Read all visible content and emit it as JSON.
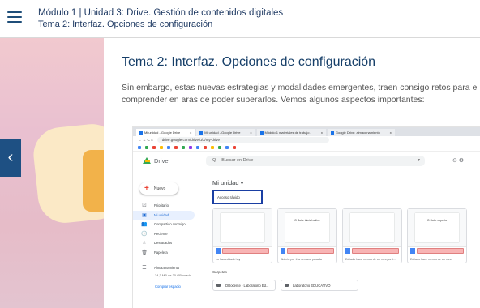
{
  "header": {
    "breadcrumb": "Módulo 1 | Unidad 3: Drive. Gestión de contenidos digitales",
    "subtitle": "Tema 2: Interfaz. Opciones de configuración"
  },
  "nav": {
    "prev_icon": "chevron-left-icon",
    "prev_glyph": "‹"
  },
  "content": {
    "title": "Tema 2: Interfaz. Opciones de configuración",
    "paragraph": "Sin embargo, estas nuevas estrategias y modalidades emergentes, traen consigo retos para el comprender en aras de poder superarlos. Vemos algunos aspectos importantes:"
  },
  "screenshot": {
    "tabs": [
      {
        "label": "Mi unidad - Google Drive",
        "close": "x"
      },
      {
        "label": "Mi unidad - Google Drive",
        "close": "x"
      },
      {
        "label": "Módulo 1 materiales de trabajo -",
        "close": "x"
      },
      {
        "label": "Google Drive: almacenamiento",
        "close": "x"
      }
    ],
    "url": "drive.google.com/drive/u/3/my-drive",
    "drive_label": "Drive",
    "search_placeholder": "Buscar en Drive",
    "new_button": "Nuevo",
    "sidebar": [
      {
        "icon": "☑",
        "label": "Prioritario"
      },
      {
        "icon": "▣",
        "label": "Mi unidad"
      },
      {
        "icon": "👥",
        "label": "Compartido conmigo"
      },
      {
        "icon": "🕒",
        "label": "Reciente"
      },
      {
        "icon": "☆",
        "label": "Destacados"
      },
      {
        "icon": "🗑",
        "label": "Papelera"
      },
      {
        "icon": "☰",
        "label": "Almacenamiento"
      }
    ],
    "storage": "34,3 MB de 30 GB usado",
    "buy_storage": "Comprar espacio",
    "my_drive": "Mi unidad",
    "quick_access": "Acceso rápido",
    "cards": [
      {
        "doc_title": "",
        "foot": "Lo has editado hoy"
      },
      {
        "doc_title": "G Suite inicial online",
        "foot": "Abierto por ti la semana pasada"
      },
      {
        "doc_title": "",
        "foot": "Editado hace menos de un mes por t..."
      },
      {
        "doc_title": "G Suite experto",
        "foot": "Editado hace menos de un mes"
      }
    ],
    "folders_label": "Carpetas",
    "folders": [
      "IDDocente - Laboratorio Ed...",
      "Laboratorio EDUCATIVO"
    ]
  }
}
